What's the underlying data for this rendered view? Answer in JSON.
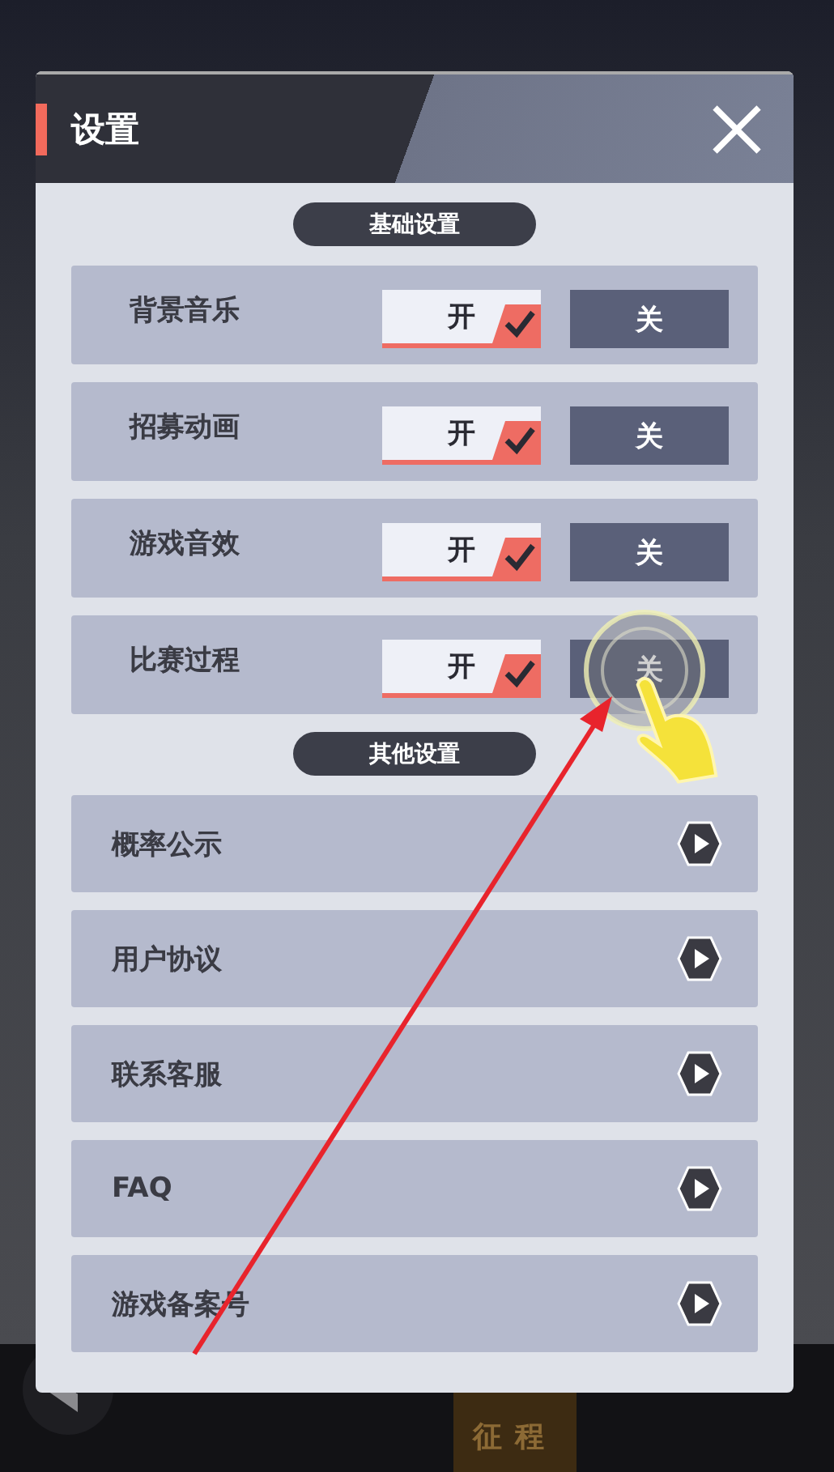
{
  "dialog": {
    "title": "设置",
    "sections": [
      {
        "heading": "基础设置",
        "kind": "toggles",
        "items": [
          {
            "label": "背景音乐",
            "on_label": "开",
            "off_label": "关",
            "on": true
          },
          {
            "label": "招募动画",
            "on_label": "开",
            "off_label": "关",
            "on": true
          },
          {
            "label": "游戏音效",
            "on_label": "开",
            "off_label": "关",
            "on": true
          },
          {
            "label": "比赛过程",
            "on_label": "开",
            "off_label": "关",
            "on": true
          }
        ]
      },
      {
        "heading": "其他设置",
        "kind": "links",
        "items": [
          {
            "label": "概率公示"
          },
          {
            "label": "用户协议"
          },
          {
            "label": "联系客服"
          },
          {
            "label": "FAQ"
          },
          {
            "label": "游戏备案号"
          }
        ]
      }
    ]
  },
  "bottom_nav": {
    "tab": "征程"
  }
}
